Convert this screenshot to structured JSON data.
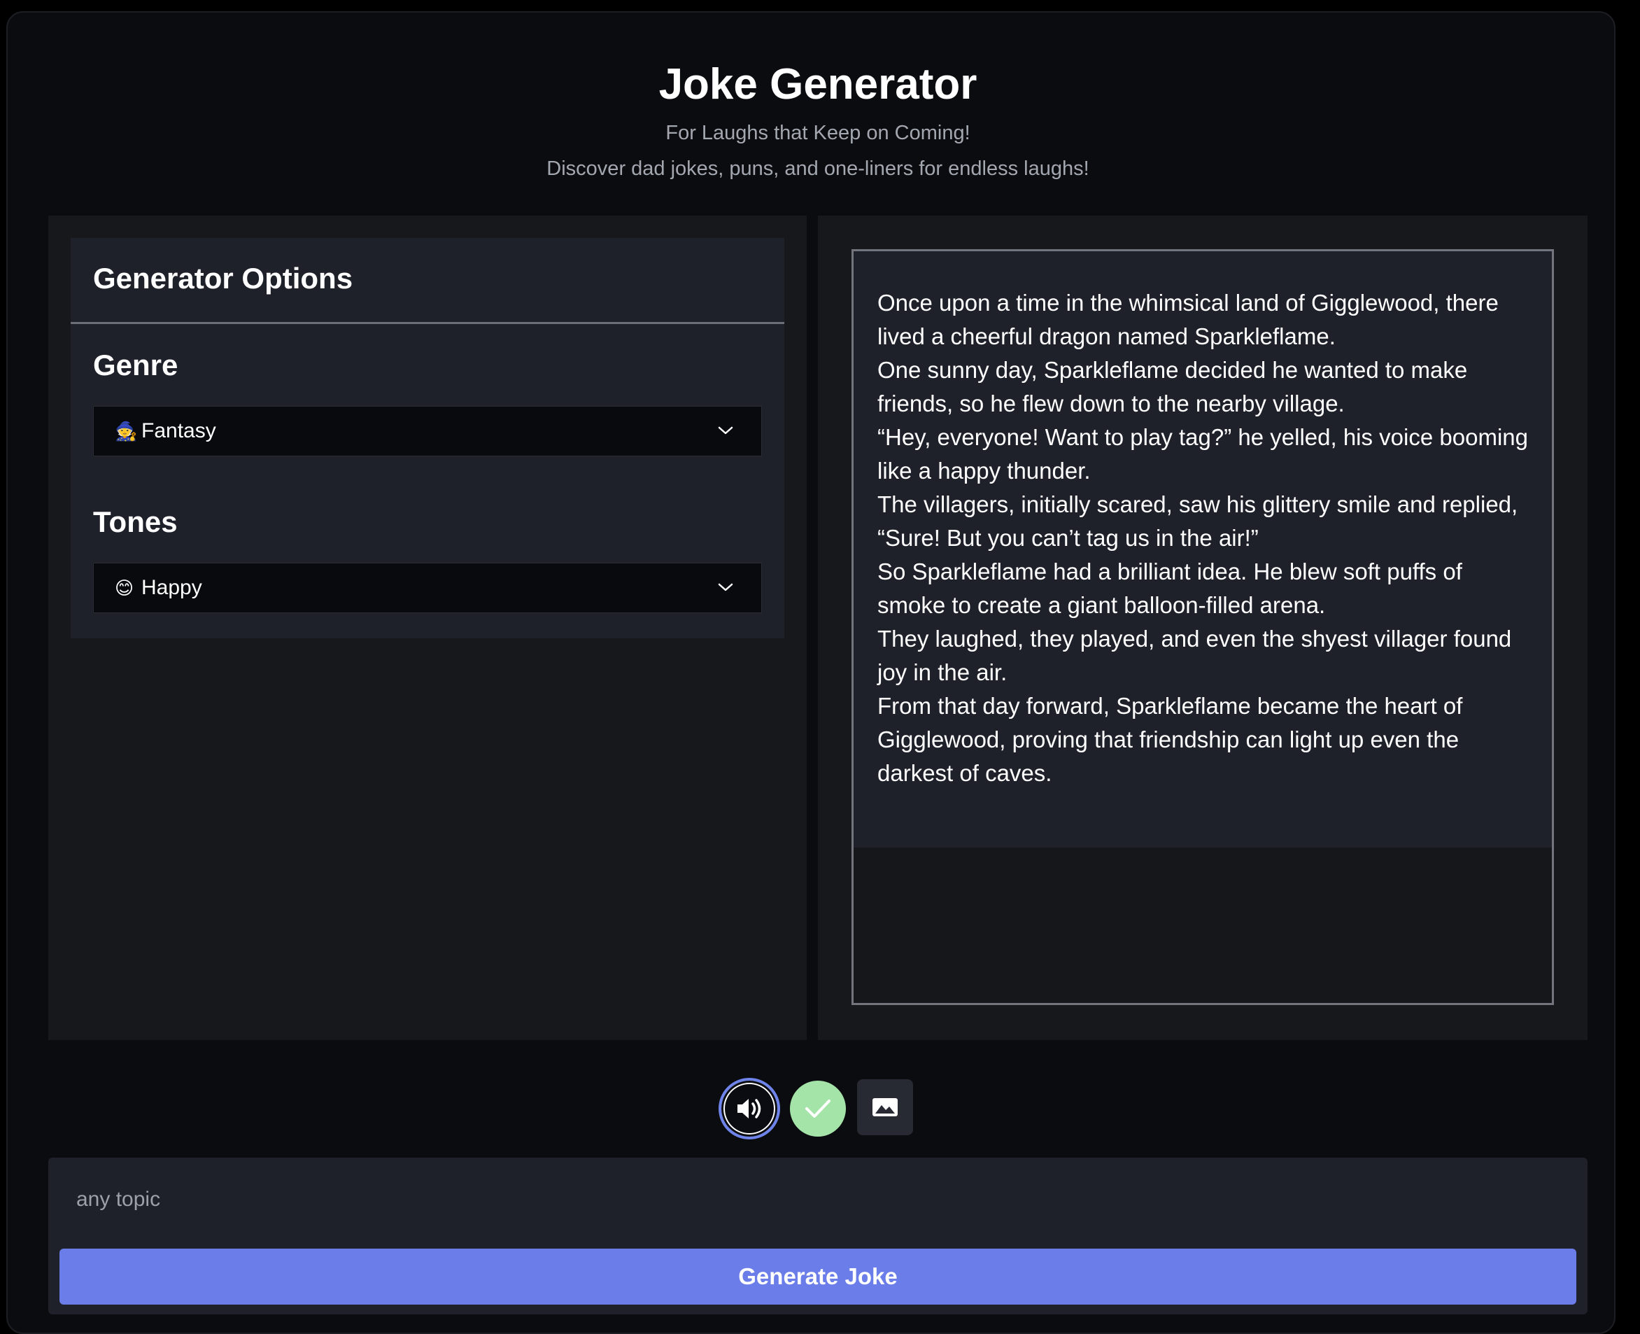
{
  "header": {
    "title": "Joke Generator",
    "tagline": "For Laughs that Keep on Coming!",
    "subtitle": "Discover dad jokes, puns, and one-liners for endless laughs!"
  },
  "options": {
    "title": "Generator Options",
    "genre": {
      "label": "Genre",
      "emoji": "🧙",
      "selected": "Fantasy"
    },
    "tones": {
      "label": "Tones",
      "emoji": "😊",
      "selected": "Happy"
    }
  },
  "story": {
    "lines": [
      "Once upon a time in the whimsical land of Gigglewood, there lived a cheerful dragon named Sparkleflame.",
      "One sunny day, Sparkleflame decided he wanted to make friends, so he flew down to the nearby village.",
      "“Hey, everyone! Want to play tag?” he yelled, his voice booming like a happy thunder.",
      "The villagers, initially scared, saw his glittery smile and replied,",
      "“Sure! But you can’t tag us in the air!”",
      "So Sparkleflame had a brilliant idea. He blew soft puffs of smoke to create a giant balloon-filled arena.",
      "They laughed, they played, and even the shyest villager found joy in the air.",
      "From that day forward, Sparkleflame became the heart of Gigglewood, proving that friendship can light up even the darkest of caves."
    ]
  },
  "actions": {
    "audio_icon": "speaker-icon",
    "check_icon": "checkmark-icon",
    "image_icon": "image-icon"
  },
  "input": {
    "placeholder": "any topic",
    "value": ""
  },
  "generate_button": {
    "label": "Generate Joke"
  },
  "colors": {
    "accent": "#6a7de8",
    "success": "#a4e4a8",
    "background": "#0b0c0f",
    "panel": "#1f212a"
  }
}
